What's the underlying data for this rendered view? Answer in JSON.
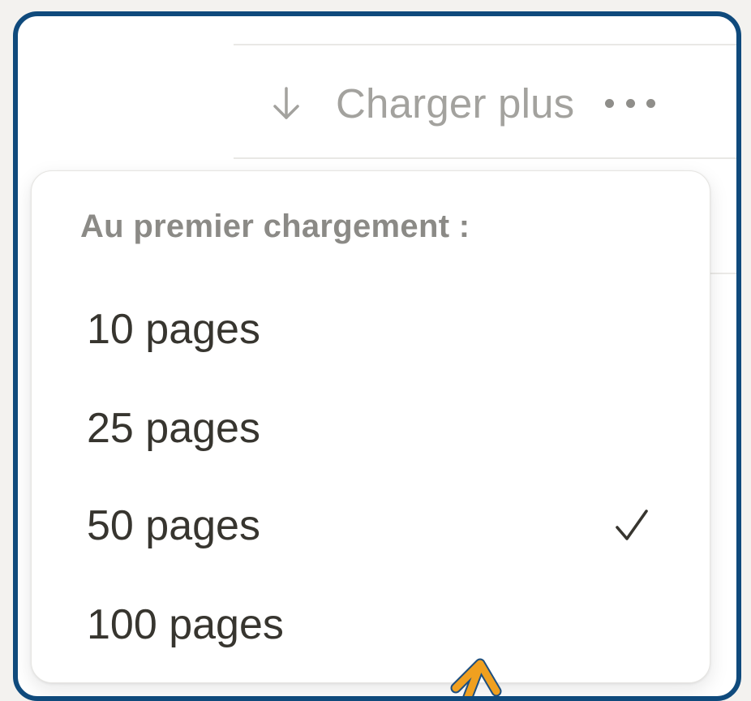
{
  "toolbar": {
    "load_more_label": "Charger plus",
    "load_more_icon": "arrow-down-icon",
    "more_icon": "more-horizontal-icon"
  },
  "dropdown": {
    "heading": "Au premier chargement :",
    "options": [
      {
        "label": "10 pages",
        "selected": false
      },
      {
        "label": "25 pages",
        "selected": false
      },
      {
        "label": "50 pages",
        "selected": true
      },
      {
        "label": "100 pages",
        "selected": false
      }
    ],
    "check_icon": "checkmark-icon"
  },
  "colors": {
    "frame_border": "#0f4a7c",
    "muted_text": "#a3a29e",
    "heading_text": "#8b8a86",
    "item_text": "#37352f",
    "cursor": "#f0a020"
  }
}
